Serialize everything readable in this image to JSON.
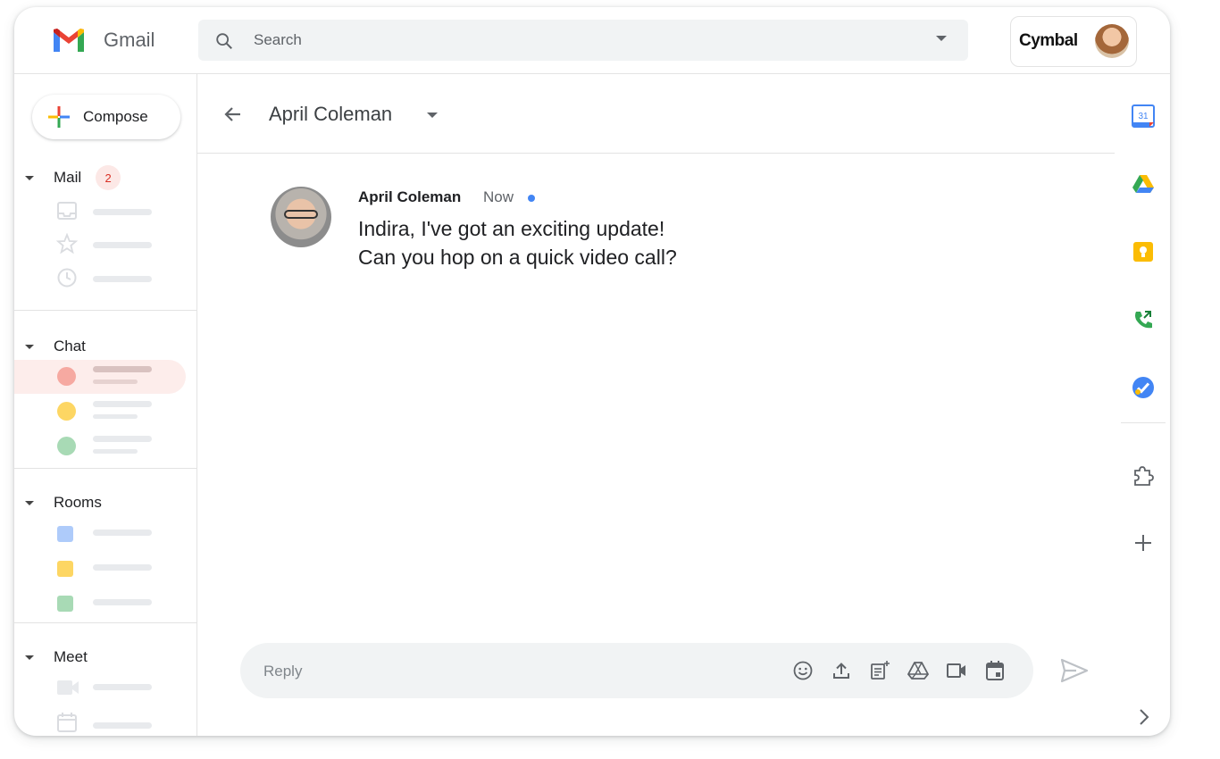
{
  "app": {
    "name": "Gmail"
  },
  "search": {
    "placeholder": "Search"
  },
  "account": {
    "brand": "Cymbal"
  },
  "sidebar": {
    "compose_label": "Compose",
    "sections": {
      "mail": {
        "label": "Mail",
        "badge": "2"
      },
      "chat": {
        "label": "Chat"
      },
      "rooms": {
        "label": "Rooms"
      },
      "meet": {
        "label": "Meet"
      }
    }
  },
  "conversation": {
    "title": "April Coleman",
    "message": {
      "sender": "April Coleman",
      "timestamp": "Now",
      "line1": "Indira, I've got an exciting update!",
      "line2": "Can you hop on a quick video call?"
    },
    "reply_placeholder": "Reply"
  },
  "rail": {
    "calendar_day": "31"
  },
  "colors": {
    "gmail_red": "#ea4335",
    "google_blue": "#4285f4",
    "google_green": "#34a853",
    "google_yellow": "#fbbc04",
    "selected_chat_bg": "#fce8e6"
  }
}
